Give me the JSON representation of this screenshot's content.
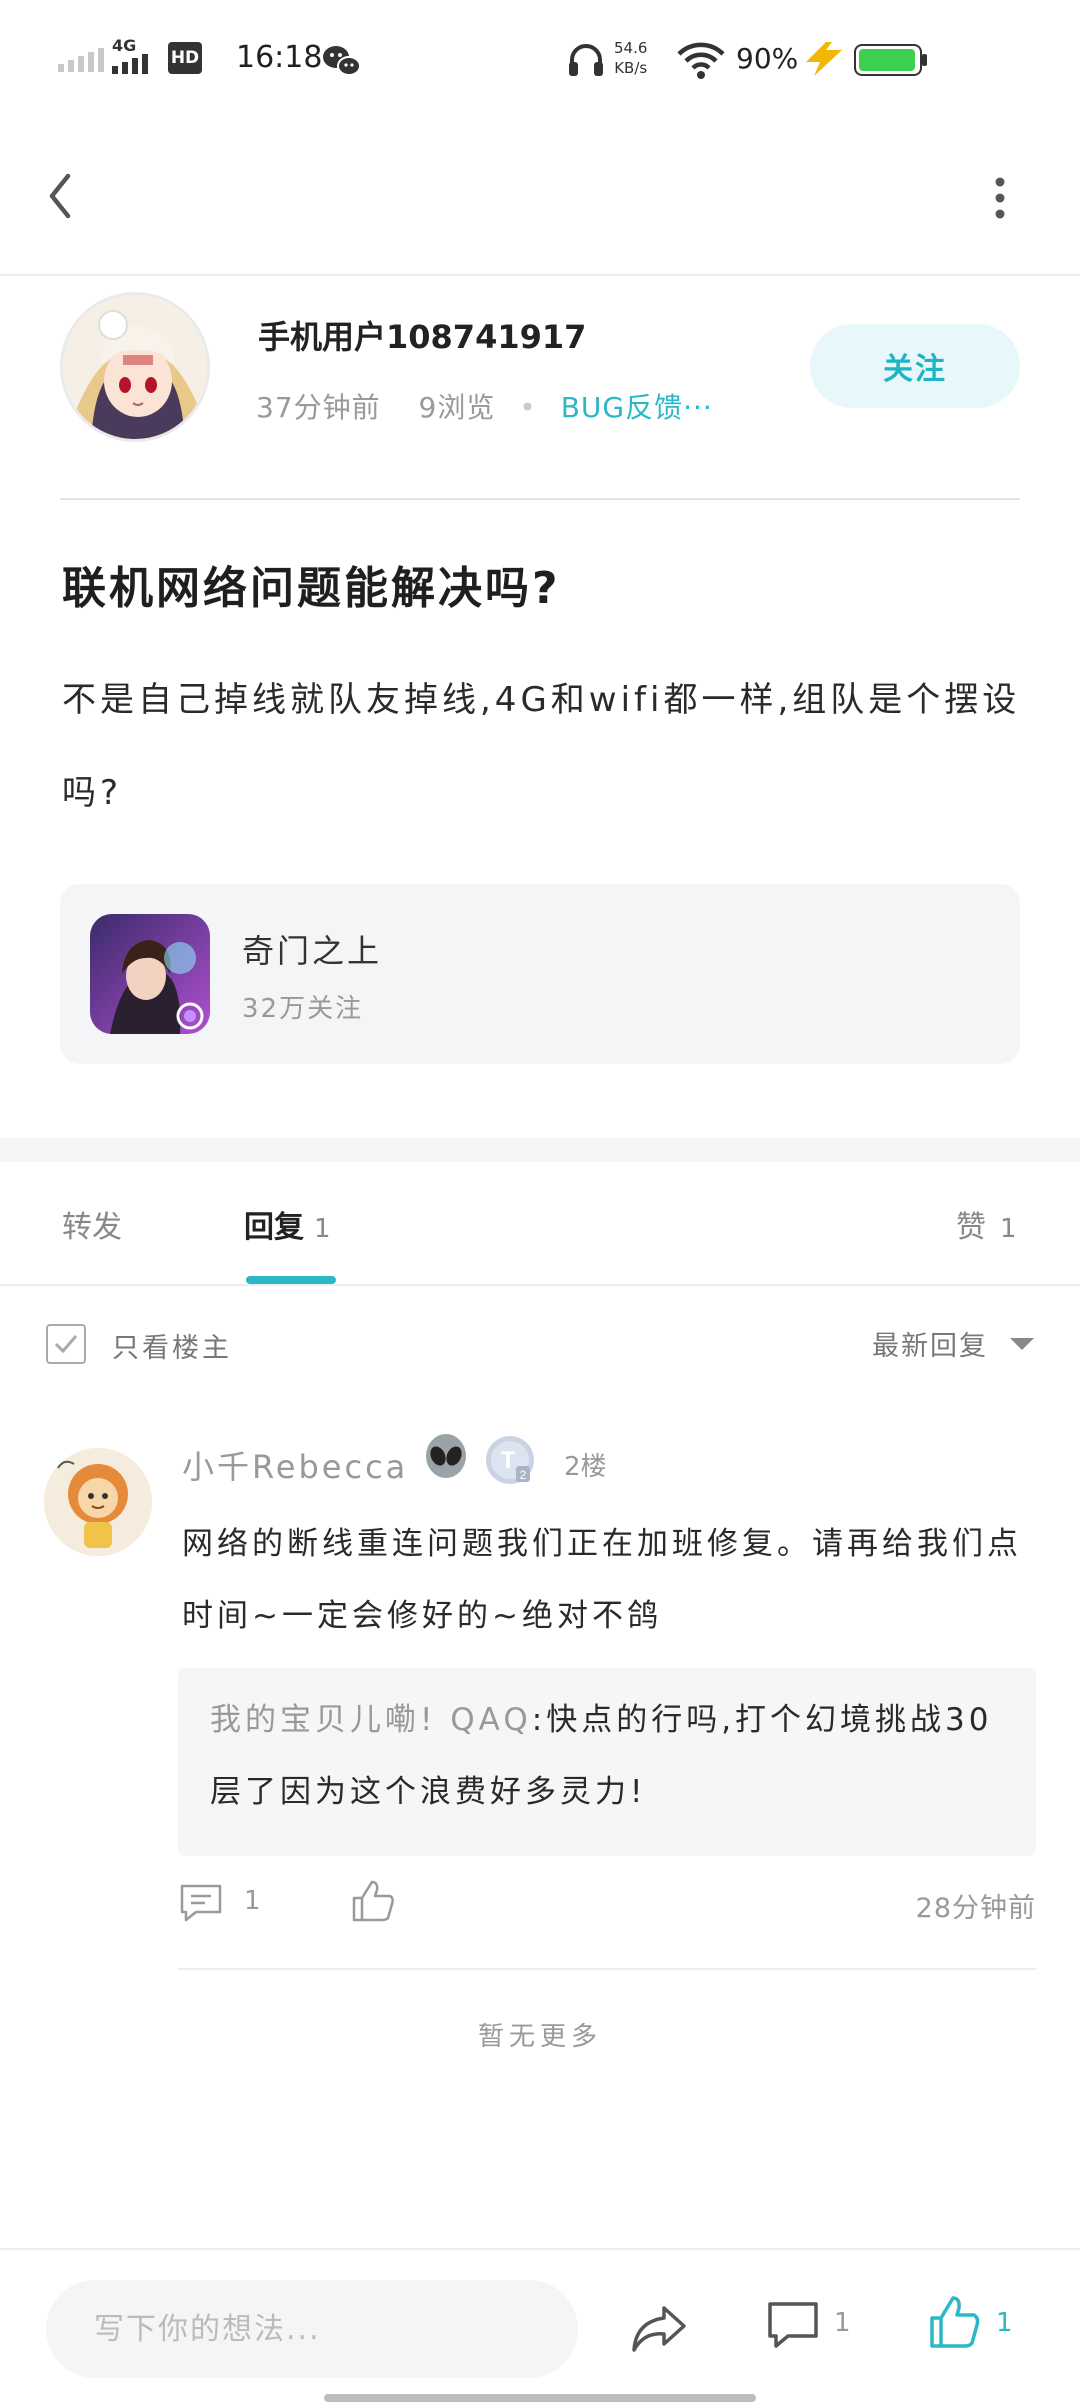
{
  "status_bar": {
    "time": "16:18",
    "net_speed_value": "54.6",
    "net_speed_unit": "KB/s",
    "battery_percent": "90%",
    "network": "4G",
    "hd_label": "HD"
  },
  "post": {
    "author": {
      "username": "手机用户108741917",
      "time_ago": "37分钟前",
      "views": "9浏览",
      "category": "BUG反馈···",
      "follow_label": "关注"
    },
    "title": "联机网络问题能解决吗?",
    "body": "不是自己掉线就队友掉线,4G和wifi都一样,组队是个摆设吗?",
    "game": {
      "name": "奇门之上",
      "followers": "32万关注"
    }
  },
  "tabs": {
    "repost_label": "转发",
    "reply_label": "回复",
    "reply_count": "1",
    "like_label": "赞",
    "like_count": "1"
  },
  "filter": {
    "only_owner_label": "只看楼主",
    "sort_label": "最新回复"
  },
  "comments": [
    {
      "username": "小千Rebecca",
      "floor": "2楼",
      "badge2_letter": "T",
      "badge2_sub": "2",
      "body": "网络的断线重连问题我们正在加班修复。请再给我们点时间~一定会修好的~绝对不鸽",
      "quote_user": "我的宝贝儿嘞! QAQ",
      "quote_text": ":快点的行吗,打个幻境挑战30层了因为这个浪费好多灵力!",
      "reply_count": "1",
      "time_ago": "28分钟前"
    }
  ],
  "no_more_label": "暂无更多",
  "bottom_bar": {
    "input_placeholder": "写下你的想法...",
    "comment_count": "1",
    "like_count": "1"
  },
  "colors": {
    "accent": "#2bb8c6",
    "follow_bg": "#e8f7f9",
    "card_bg": "#f4f5f7",
    "battery": "#3fcf4f"
  }
}
